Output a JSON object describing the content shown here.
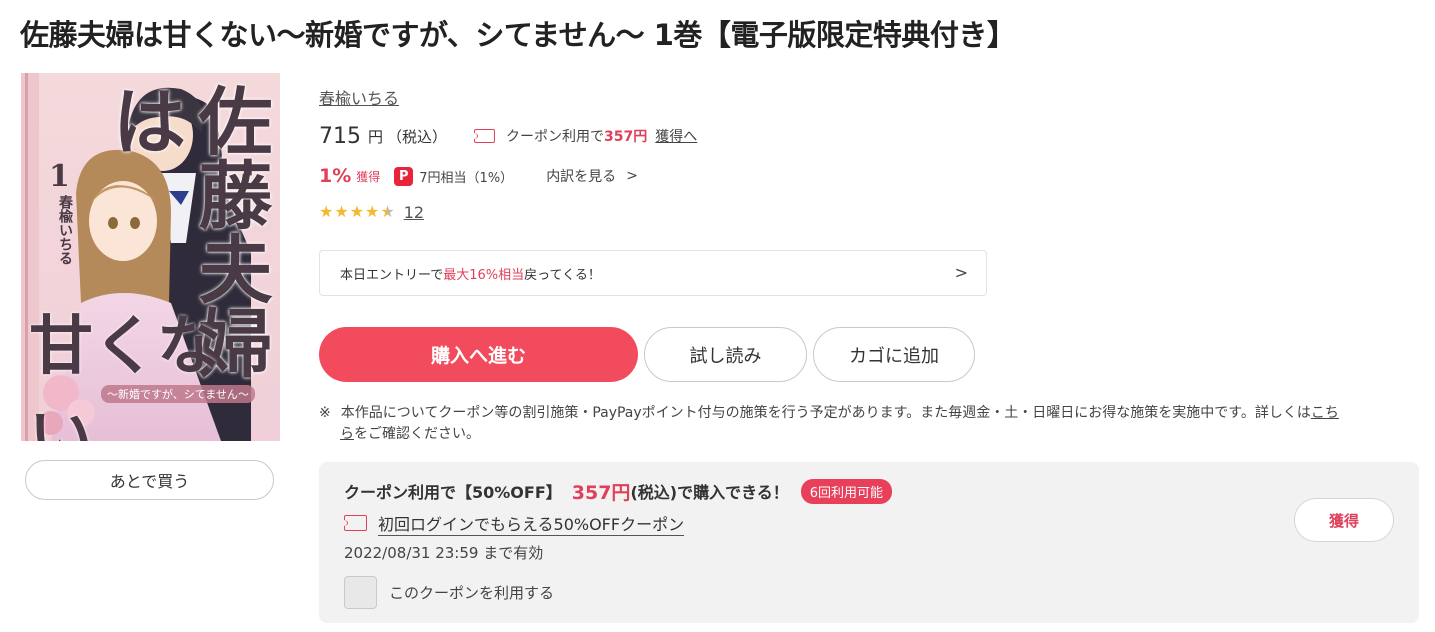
{
  "title": "佐藤夫婦は甘くない～新婚ですが、シてません～ 1巻【電子版限定特典付き】",
  "cover": {
    "title_text": "佐藤夫婦は",
    "kana_text": "甘くない",
    "volume": "1",
    "author": "春楡いちる",
    "subtitle": "～新婚ですが、シてません～"
  },
  "later_button": "あとで買う",
  "author": "春楡いちる",
  "price": {
    "amount": "715",
    "yen": "円",
    "tax": "（税込）",
    "coupon_prefix": "クーポン利用で",
    "coupon_price": "357円",
    "get_link": "獲得へ"
  },
  "points": {
    "percent": "1%",
    "get": "獲得",
    "paypay_icon_label": "P",
    "paypay_text": "7円相当（1%）",
    "breakdown": "内訳を見る"
  },
  "rating": {
    "stars": 4.5,
    "count": "12"
  },
  "entry_banner": {
    "before": "本日エントリーで",
    "highlight": "最大16%相当",
    "after": "戻ってくる！"
  },
  "buttons": {
    "buy": "購入へ進む",
    "trial": "試し読み",
    "cart": "カゴに追加"
  },
  "note": {
    "mark": "※",
    "text": "本作品についてクーポン等の割引施策・PayPayポイント付与の施策を行う予定があります。また毎週金・土・日曜日にお得な施策を実施中です。詳しくは",
    "link_part1": "こち",
    "link_part2": "ら",
    "tail": "をご確認ください。"
  },
  "coupon_box": {
    "head_before": "クーポン利用で【50%OFF】",
    "price": "357円",
    "head_after": "(税込)で購入できる！",
    "badge": "6回利用可能",
    "name": "初回ログインでもらえる50%OFFクーポン",
    "expiry": "2022/08/31 23:59 まで有効",
    "checkbox_label": "このクーポンを利用する",
    "get_button": "獲得"
  },
  "colors": {
    "accent": "#f24b5d",
    "accent_text": "#e0405a",
    "star": "#f5b82e",
    "paypay": "#e8243a",
    "panel_bg": "#f2f2f2"
  },
  "icons": {
    "coupon": "coupon-ticket-icon",
    "paypay": "paypay-icon",
    "chevron": "chevron-right-icon",
    "star": "star-icon"
  }
}
